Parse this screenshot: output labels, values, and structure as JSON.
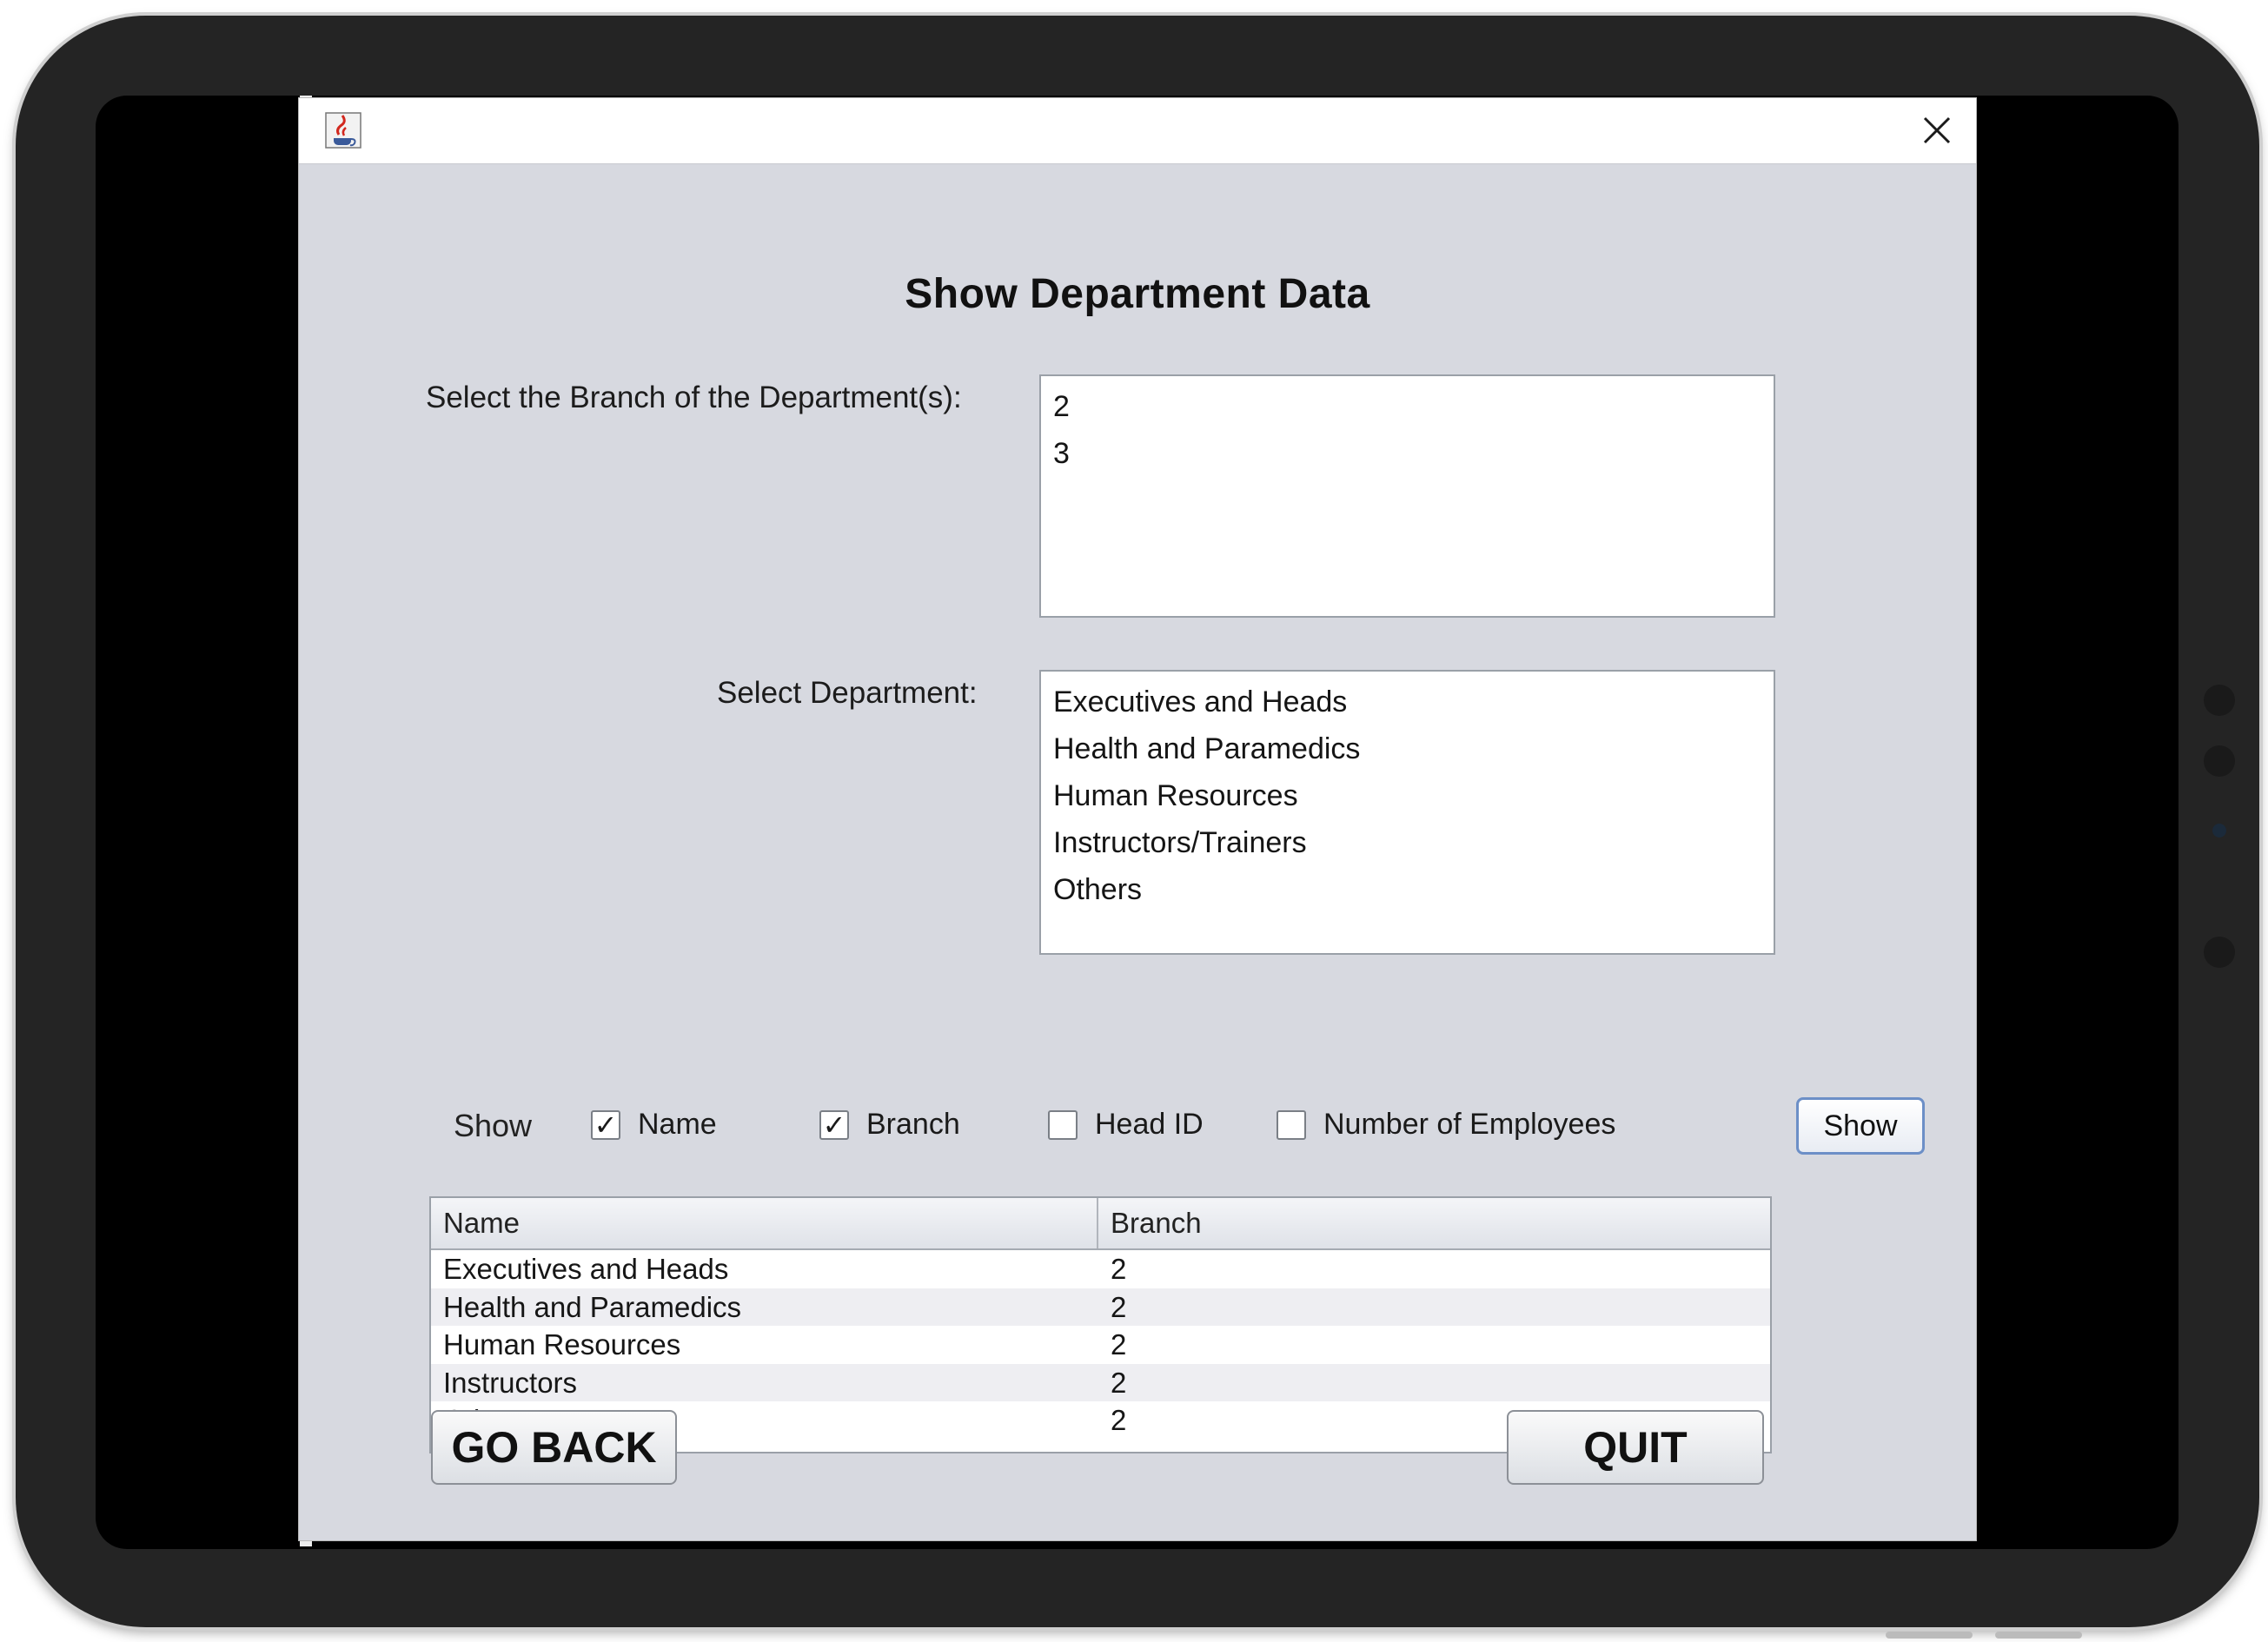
{
  "window": {
    "title": "",
    "heading": "Show Department Data"
  },
  "branch_select": {
    "label": "Select the Branch of the Department(s):",
    "options": [
      "2",
      "3"
    ]
  },
  "department_select": {
    "label": "Select Department:",
    "options": [
      "Executives and Heads",
      "Health and Paramedics",
      "Human Resources",
      "Instructors/Trainers",
      "Others"
    ]
  },
  "show_options": {
    "label": "Show",
    "checkboxes": [
      {
        "label": "Name",
        "checked": true
      },
      {
        "label": "Branch",
        "checked": true
      },
      {
        "label": "Head ID",
        "checked": false
      },
      {
        "label": "Number of Employees",
        "checked": false
      }
    ],
    "button_label": "Show"
  },
  "results_table": {
    "columns": [
      "Name",
      "Branch"
    ],
    "rows": [
      [
        "Executives and Heads",
        "2"
      ],
      [
        "Health and Paramedics",
        "2"
      ],
      [
        "Human Resources",
        "2"
      ],
      [
        "Instructors",
        "2"
      ],
      [
        "Others",
        "2"
      ]
    ]
  },
  "footer": {
    "back_label": "GO BACK",
    "quit_label": "QUIT"
  },
  "icons": {
    "app_icon": "java-coffee-cup-icon",
    "close_icon": "close-icon"
  }
}
